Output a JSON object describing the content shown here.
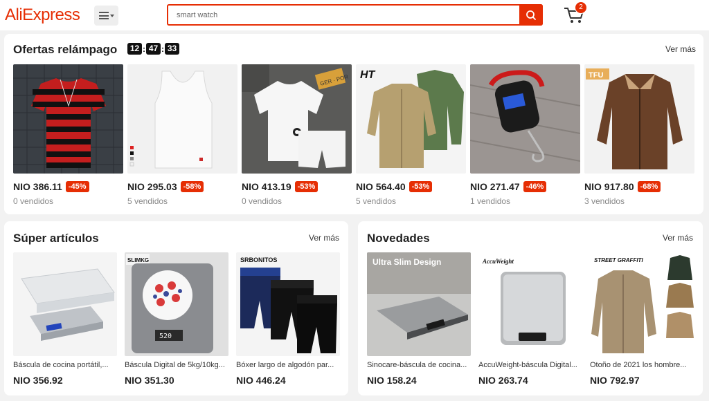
{
  "header": {
    "logo": "AliExpress",
    "search_value": "smart watch",
    "cart_count": "2"
  },
  "flash": {
    "title": "Ofertas relámpago",
    "timer": [
      "12",
      "47",
      "33"
    ],
    "more": "Ver más",
    "items": [
      {
        "price": "NIO 386.11",
        "discount": "-45%",
        "sold": "0 vendidos"
      },
      {
        "price": "NIO 295.03",
        "discount": "-58%",
        "sold": "5 vendidos"
      },
      {
        "price": "NIO 413.19",
        "discount": "-53%",
        "sold": "0 vendidos"
      },
      {
        "price": "NIO 564.40",
        "discount": "-53%",
        "sold": "5 vendidos"
      },
      {
        "price": "NIO 271.47",
        "discount": "-46%",
        "sold": "1 vendidos"
      },
      {
        "price": "NIO 917.80",
        "discount": "-68%",
        "sold": "3 vendidos"
      }
    ]
  },
  "super": {
    "title": "Súper artículos",
    "more": "Ver más",
    "items": [
      {
        "name": "Báscula de cocina portátil,...",
        "price": "NIO 356.92"
      },
      {
        "name": "Báscula Digital de 5kg/10kg...",
        "price": "NIO 351.30"
      },
      {
        "name": "Bóxer largo de algodón par...",
        "price": "NIO 446.24"
      }
    ]
  },
  "new": {
    "title": "Novedades",
    "more": "Ver más",
    "items": [
      {
        "name": "Sinocare-báscula de cocina...",
        "price": "NIO 158.24"
      },
      {
        "name": "AccuWeight-báscula Digital...",
        "price": "NIO 263.74"
      },
      {
        "name": "Otoño de 2021 los hombre...",
        "price": "NIO 792.97"
      }
    ]
  },
  "image_text": {
    "jacket_brand": "HT",
    "jacket2_brand": "TFU",
    "scale_brand": "SLIMKG",
    "scale_display": "520",
    "boxer_brand": "SRBONITOS",
    "ultra_slim": "Ultra Slim Design",
    "accuweight": "AccuWeight",
    "street": "STREET GRAFFITI",
    "plate": "GER · POR"
  },
  "colors": {
    "accent": "#e62e04",
    "text": "#222222",
    "muted": "#888888"
  }
}
